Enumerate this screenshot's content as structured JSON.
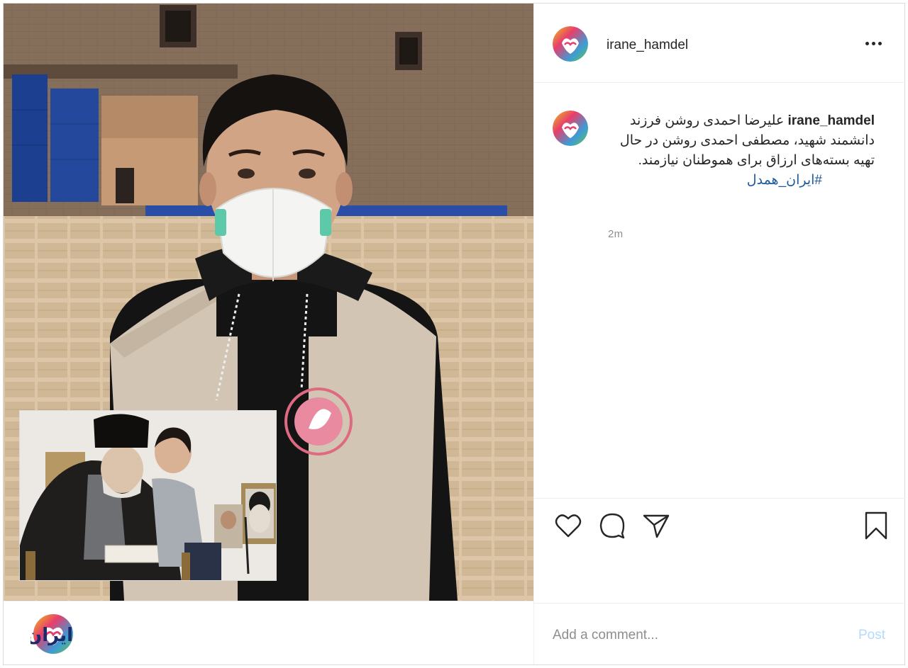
{
  "post": {
    "username": "irane_hamdel",
    "caption_user": "irane_hamdel",
    "caption_text": "علیرضا احمدی روشن فرزند دانشمند شهید، مصطفی احمدی روشن در حال تهیه بسته‌های ارزاق برای هموطنان نیازمند.",
    "hashtag": "#ایران_همدل",
    "time_ago": "2m"
  },
  "comment": {
    "placeholder": "Add a comment...",
    "post_label": "Post"
  },
  "footer_logo": {
    "wordmark": "ایران همدل"
  },
  "icons": {
    "more": "more-options-icon",
    "like": "heart-icon",
    "comment": "comment-bubble-icon",
    "share": "paper-plane-icon",
    "save": "bookmark-icon"
  },
  "colors": {
    "accent_link": "#1c5a9c",
    "post_button_disabled": "#b3dbff",
    "muted_text": "#8e8e8e",
    "border": "#dbdbdb"
  }
}
